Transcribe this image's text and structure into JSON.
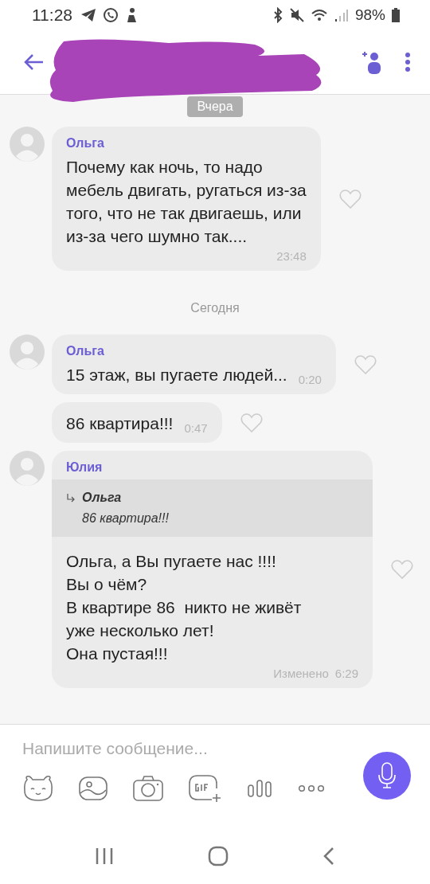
{
  "status_bar": {
    "time": "11:28",
    "battery": "98%"
  },
  "header": {
    "title_hidden": true
  },
  "messages": [
    {
      "kind": "date",
      "label": "Вчера"
    },
    {
      "kind": "message",
      "avatar": true,
      "sender": "Ольга",
      "text": "Почему как ночь, то надо\nмебель двигать, ругаться из-за\nтого, что не так двигаешь, или\nиз-за чего шумно так....",
      "time": "23:48",
      "liked": false
    },
    {
      "kind": "date",
      "label": "Сегодня"
    },
    {
      "kind": "message",
      "avatar": true,
      "sender": "Ольга",
      "text": "15 этаж, вы пугаете людей...",
      "time": "0:20",
      "liked": false
    },
    {
      "kind": "message",
      "avatar": false,
      "text": "86 квартира!!!",
      "time": "0:47",
      "liked": false
    },
    {
      "kind": "message",
      "avatar": true,
      "sender": "Юлия",
      "reply": {
        "sender": "Ольга",
        "text": "86 квартира!!!"
      },
      "text": "Ольга, а Вы пугаете нас !!!!\nВы о чём?\nВ квартире 86  никто не живёт\nуже несколько лет!\nОна пустая!!!",
      "edited": "Изменено",
      "time": "6:29",
      "liked": false
    }
  ],
  "composer": {
    "placeholder": "Напишите сообщение..."
  }
}
